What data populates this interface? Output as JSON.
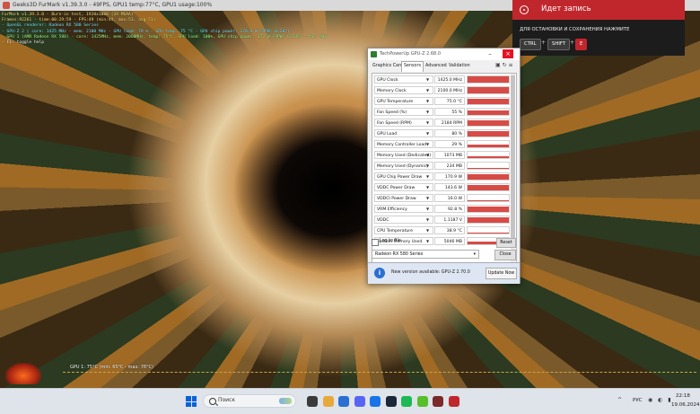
{
  "furmark": {
    "window_title": "Geeks3D FurMark v1.39.3.0 - 49FPS, GPU1 temp:77°C, GPU1 usage:100%",
    "osd_lines": [
      "FurMark v1.39.3.0 - Burn-in test, 1920x1080 (2X MSAA)",
      "Frames:92261 - time:00:29:59 - FPS:49 (min:49, max:53, avg:51)",
      "- OpenGL renderer: Radeon RX 580 Series",
      "- GPU-Z 2 | core: 1425 MHz - mem: 2100 MHz - GPU load: 79 % - GPU temp: 75 °C - GPU chip power: 170.9 W (PPW: 0.287)",
      "- GPU 1 (AMD Radeon RX 580) - core: 1425MHz, mem: 2000MHz, temp: 75°C, GPU load: 100%, GPU chip power: 172 W (PPW: 0.285), fan: 94%",
      "- F1: toggle help"
    ],
    "graph_label": "GPU 1: 75°C (min: 65°C - max: 76°C)"
  },
  "recording": {
    "title": "Идет запись",
    "hint": "ДЛЯ ОСТАНОВКИ И СОХРАНЕНИЯ НАЖМИТЕ",
    "keys": [
      "CTRL",
      "SHIFT",
      "E"
    ],
    "plus": "+"
  },
  "gpuz": {
    "title": "TechPowerUp GPU-Z 2.68.0",
    "tabs": [
      "Graphics Card",
      "Sensors",
      "Advanced",
      "Validation"
    ],
    "active_tab": "Sensors",
    "tab_icons": "▣ ↻ ≡",
    "sensors": [
      {
        "name": "GPU Clock",
        "value": "1425.0 MHz",
        "fill": 0.95
      },
      {
        "name": "Memory Clock",
        "value": "2100.0 MHz",
        "fill": 0.95
      },
      {
        "name": "GPU Temperature",
        "value": "75.0 °C",
        "fill": 0.9
      },
      {
        "name": "Fan Speed (%)",
        "value": "55 %",
        "fill": 0.75
      },
      {
        "name": "Fan Speed (RPM)",
        "value": "2184 RPM",
        "fill": 0.85
      },
      {
        "name": "GPU Load",
        "value": "80 %",
        "fill": 0.92
      },
      {
        "name": "Memory Controller Load",
        "value": "29 %",
        "fill": 0.45
      },
      {
        "name": "Memory Used (Dedicated)",
        "value": "1073 MB",
        "fill": 0.35
      },
      {
        "name": "Memory Used (Dynamic)",
        "value": "234 MB",
        "fill": 0.2
      },
      {
        "name": "GPU Chip Power Draw",
        "value": "170.9 W",
        "fill": 0.9
      },
      {
        "name": "VDDC Power Draw",
        "value": "143.6 W",
        "fill": 0.88
      },
      {
        "name": "VDDCI Power Draw",
        "value": "16.0 W",
        "fill": 0.1
      },
      {
        "name": "VRM Efficiency",
        "value": "92.8 %",
        "fill": 0.9
      },
      {
        "name": "VDDC",
        "value": "1.1187 V",
        "fill": 0.88
      },
      {
        "name": "CPU Temperature",
        "value": "38.9 °C",
        "fill": 0.15
      },
      {
        "name": "System Memory Used",
        "value": "5046 MB",
        "fill": 0.5
      }
    ],
    "log_label": "Log to file",
    "reset_label": "Reset",
    "card_select": "Radeon RX 580 Series",
    "close_label": "Close",
    "update_text": "New version available: GPU-Z 2.70.0",
    "update_button": "Update Now"
  },
  "taskbar": {
    "search_placeholder": "Поиск",
    "tray_arrow": "^",
    "language": "РУС",
    "tray_icons": "◉ ◐ ▮",
    "time": "22:18",
    "date": "19.06.2024",
    "app_colors": [
      "#3b3b3b",
      "#e8a93b",
      "#2a6fd1",
      "#5865f2",
      "#1a73e8",
      "#1b2838",
      "#1db954",
      "#56c02c",
      "#7a2a2a",
      "#c0272d"
    ]
  }
}
